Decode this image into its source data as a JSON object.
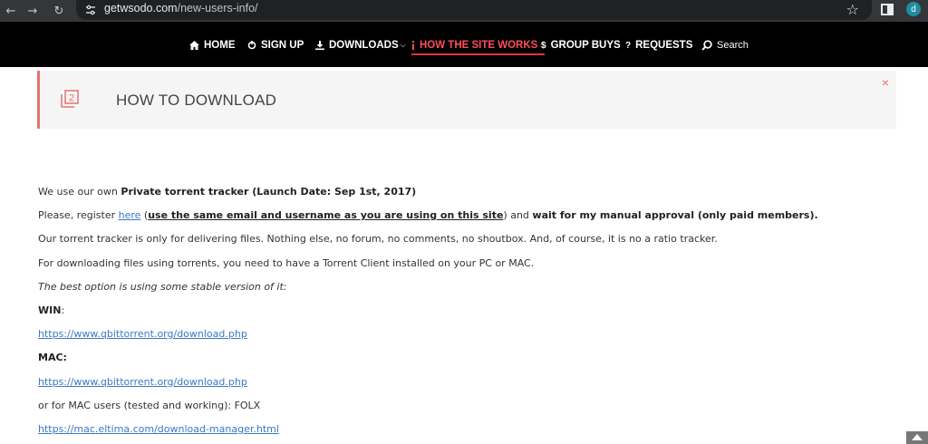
{
  "browser": {
    "url_domain": "getwsodo.com",
    "url_path": "/new-users-info/",
    "profile_initial": "d"
  },
  "nav": {
    "items": [
      {
        "label": "HOME",
        "icon": "home-icon"
      },
      {
        "label": "SIGN UP",
        "icon": "sign-up-icon"
      },
      {
        "label": "DOWNLOADS",
        "icon": "download-icon"
      },
      {
        "label": "HOW THE SITE WORKS",
        "icon": "info-icon",
        "active": true
      },
      {
        "label": "GROUP BUYS",
        "icon": "dollar-icon"
      },
      {
        "label": "REQUESTS",
        "icon": "question-icon"
      },
      {
        "label": "Search",
        "icon": "search-icon"
      }
    ],
    "active_color": "#ff4d5a"
  },
  "notice": {
    "title": "HOW TO DOWNLOAD",
    "close_symbol": "×"
  },
  "content": {
    "l1_pre": "We use our own ",
    "l1_bold": "Private torrent tracker (Launch Date: Sep 1st, 2017)",
    "l2_pre": "Please, register ",
    "l2_link": "here",
    "l2_paren_open": " (",
    "l2_bold_u": "use the same email and username as you are using on this site",
    "l2_mid": ") and ",
    "l2_bold": "wait for my manual approval (only paid members).",
    "l3": "Our torrent tracker is only for delivering files. Nothing else, no forum, no comments, no shoutbox. And, of course, it is no a ratio tracker.",
    "l4": "For downloading files using torrents, you need to have a Torrent Client installed on your PC or MAC.",
    "l5": "The best option is using some stable version of it:",
    "win_label": "WIN",
    "win_colon": ":",
    "win_link": "https://www.qbittorrent.org/download.php",
    "mac_label": "MAC:",
    "mac_link": "https://www.qbittorrent.org/download.php",
    "folx_text": "or for MAC users (tested and working): FOLX",
    "folx_link": "https://mac.eltima.com/download-manager.html"
  }
}
